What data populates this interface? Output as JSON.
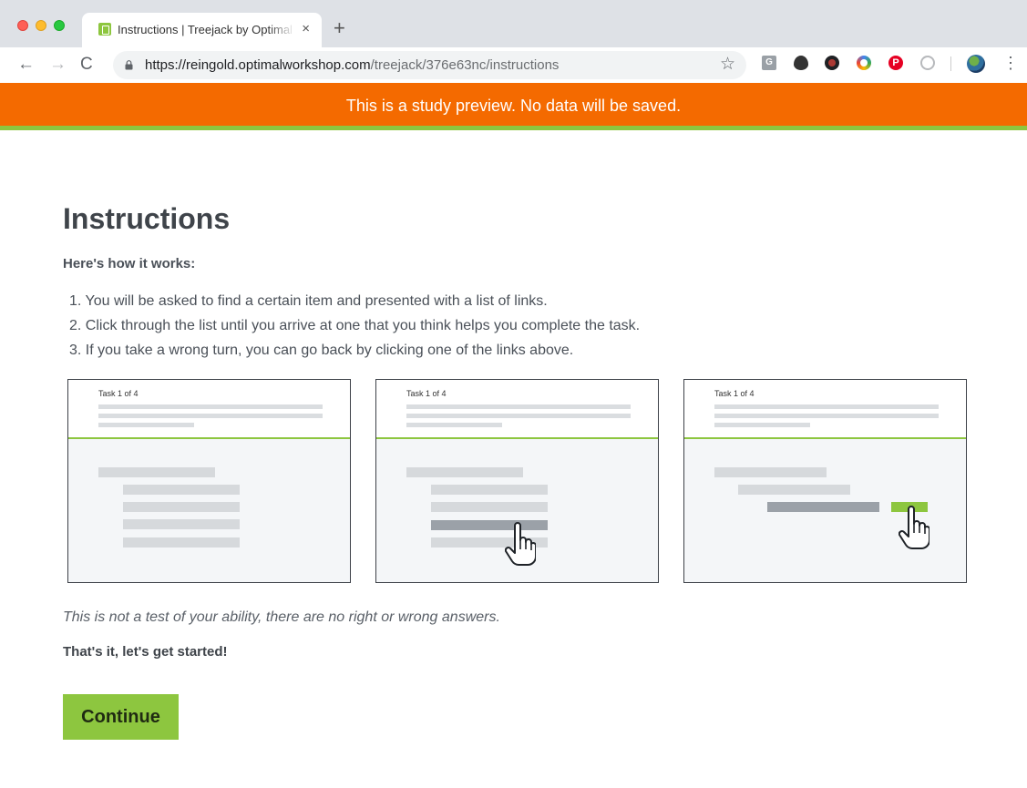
{
  "browser": {
    "tab_title": "Instructions | Treejack by Optimal Workshop",
    "tab_close": "×",
    "new_tab": "+",
    "url_host": "https://reingold.optimalworkshop.com",
    "url_path": "/treejack/376e63nc/instructions",
    "nav_back": "←",
    "nav_forward": "→",
    "nav_reload": "C",
    "star": "☆",
    "menu": "⋮",
    "extensions": [
      "G",
      "P"
    ]
  },
  "banner": {
    "text": "This is a study preview. No data will be saved."
  },
  "instructions": {
    "title": "Instructions",
    "subheading": "Here's how it works:",
    "steps": [
      "1. You will be asked to find a certain item and presented with a list of links.",
      "2. Click through the list until you arrive at one that you think helps you complete the task.",
      "3. If you take a wrong turn, you can go back by clicking one of the links above."
    ],
    "panels": [
      {
        "label": "Task 1 of 4"
      },
      {
        "label": "Task 1 of 4"
      },
      {
        "label": "Task 1 of 4"
      }
    ],
    "note": "This is not a test of your ability, there are no right or wrong answers.",
    "closing": "That's it, let's get started!",
    "continue_label": "Continue"
  },
  "colors": {
    "banner": "#f46a00",
    "accent_green": "#8dc63f",
    "text": "#3f444a"
  },
  "icons": [
    "lock-icon",
    "star-icon",
    "menu-icon",
    "hand-cursor-icon",
    "avatar"
  ]
}
